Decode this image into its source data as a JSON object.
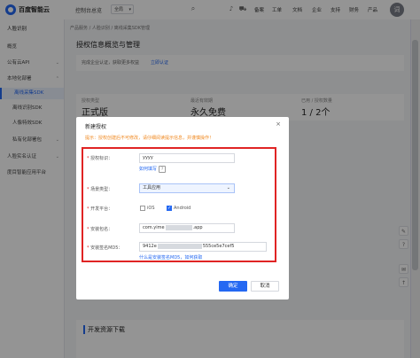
{
  "topbar": {
    "brand": "百度智能云",
    "console": "控制台总览",
    "region": "全局",
    "nav": [
      "备案",
      "工单",
      "文档",
      "企业",
      "支持",
      "财务",
      "产品"
    ],
    "avatar_letter": "词"
  },
  "sidebar": {
    "items": [
      {
        "label": "人脸识别"
      },
      {
        "label": "概览"
      },
      {
        "label": "公有云API"
      },
      {
        "label": "本地化部署"
      },
      {
        "label": "离线采集SDK"
      },
      {
        "label": "离线识别SDK"
      },
      {
        "label": "人像特效SDK"
      },
      {
        "label": "私有化部署包"
      },
      {
        "label": "人脸实名认证"
      },
      {
        "label": "度目智能应用平台"
      }
    ]
  },
  "main": {
    "breadcrumb": "产品服务  /  人脸识别  /  离线采集SDK管理",
    "title": "授权信息概览与管理",
    "notice_text": "完成企业认证，获取更多权益",
    "notice_link": "立即认证",
    "info": [
      {
        "label": "授权类型",
        "value": "正式版"
      },
      {
        "label": "最近有效期",
        "value": "永久免费"
      },
      {
        "label": "已用 / 授权数量",
        "value": "1 / 2个"
      }
    ],
    "download_title": "开发资源下载"
  },
  "modal": {
    "title": "新建授权",
    "tip": "提示：授权创建后不可修改，请仔细阅读提示信息，并谨慎操作！",
    "fields": {
      "auth_id_label": "授权标识：",
      "auth_id_value": "yyyy",
      "auth_id_help": "如何填写",
      "scene_label": "场景类型：",
      "scene_value": "工具应用",
      "platform_label": "开发平台：",
      "platform_ios": "iOS",
      "platform_android": "Android",
      "package_label": "安装包名：",
      "package_prefix": "com.yime",
      "package_suffix": ".app",
      "md5_label": "安装签名MD5：",
      "md5_prefix": "9412e",
      "md5_suffix": "555ce5e7cef5",
      "md5_help": "什么是安装签名MD5，如何获取"
    },
    "ok": "确定",
    "cancel": "取消"
  }
}
